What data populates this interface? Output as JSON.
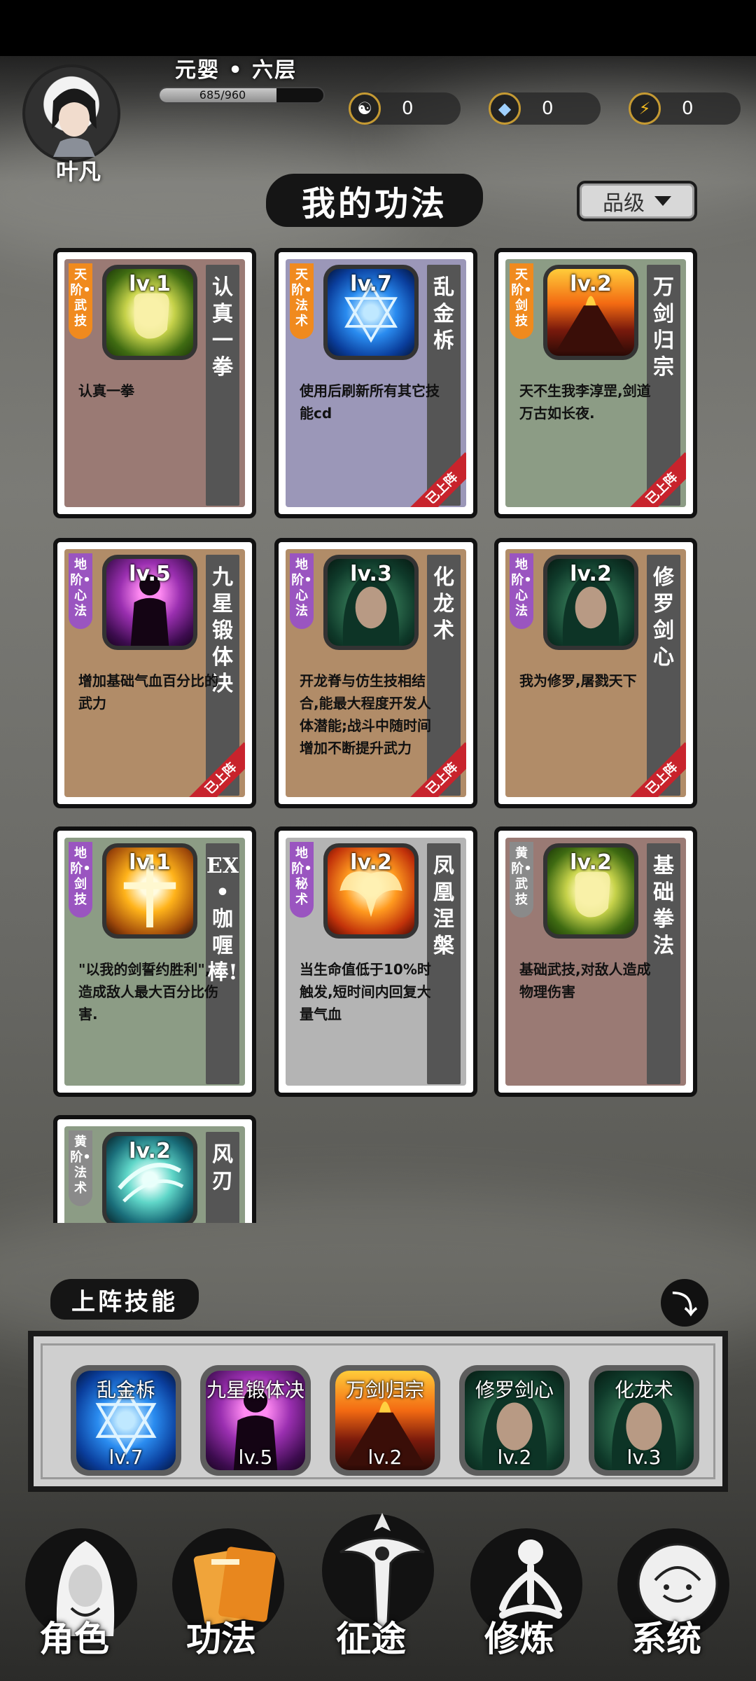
{
  "player": {
    "name": "叶凡",
    "realm": "元婴 • 六层",
    "exp_text": "685/960",
    "exp_fraction": 0.714
  },
  "resources": [
    {
      "icon": "yin-yang-icon",
      "value": "0"
    },
    {
      "icon": "crystal-icon",
      "value": "0"
    },
    {
      "icon": "lightning-icon",
      "value": "0"
    }
  ],
  "page_title": "我的功法",
  "grade_filter": {
    "label": "品级"
  },
  "skills": [
    {
      "tier": "天阶•武技",
      "tier_color": "#f08a1e",
      "bg": "#9a7a74",
      "level": "lv.1",
      "name": "认真一拳",
      "desc": "认真一拳",
      "equipped": false,
      "art": "fist-gold"
    },
    {
      "tier": "天阶•法术",
      "tier_color": "#f08a1e",
      "bg": "#9b97b8",
      "level": "lv.7",
      "name": "乱金柝",
      "desc": "使用后刷新所有其它技能cd",
      "equipped": true,
      "art": "hexagram-blue"
    },
    {
      "tier": "天阶•剑技",
      "tier_color": "#f08a1e",
      "bg": "#8c9c85",
      "level": "lv.2",
      "name": "万剑归宗",
      "desc": "天不生我李淳罡,剑道万古如长夜.",
      "equipped": true,
      "art": "volcano"
    },
    {
      "tier": "地阶•心法",
      "tier_color": "#9a55c0",
      "bg": "#b18c68",
      "level": "lv.5",
      "name": "九星锻体决",
      "desc": "增加基础气血百分比的武力",
      "equipped": true,
      "art": "shadow-purple"
    },
    {
      "tier": "地阶•心法",
      "tier_color": "#9a55c0",
      "bg": "#b18c68",
      "level": "lv.3",
      "name": "化龙术",
      "desc": "开龙脊与仿生技相结合,能最大程度开发人体潜能;战斗中随时间增加不断提升武力",
      "equipped": true,
      "art": "hood-green"
    },
    {
      "tier": "地阶•心法",
      "tier_color": "#9a55c0",
      "bg": "#b18c68",
      "level": "lv.2",
      "name": "修罗剑心",
      "desc": "我为修罗,屠戮天下",
      "equipped": true,
      "art": "hood-green"
    },
    {
      "tier": "地阶•剑技",
      "tier_color": "#9a55c0",
      "bg": "#8c9c85",
      "level": "lv.1",
      "name": "EX•咖喱棒!",
      "desc": "\"以我的剑誓约胜利\",造成敌人最大百分比伤害.",
      "equipped": false,
      "art": "cross-gold"
    },
    {
      "tier": "地阶•秘术",
      "tier_color": "#9a55c0",
      "bg": "#b4b4b4",
      "level": "lv.2",
      "name": "凤凰涅槃",
      "desc": "当生命值低于10%时触发,短时间内回复大量气血",
      "equipped": false,
      "art": "phoenix"
    },
    {
      "tier": "黄阶•武技",
      "tier_color": "#8a8a8a",
      "bg": "#9a7a74",
      "level": "lv.2",
      "name": "基础拳法",
      "desc": "基础武技,对敌人造成物理伤害",
      "equipped": false,
      "art": "fist-gold"
    },
    {
      "tier": "黄阶•法术",
      "tier_color": "#8a8a8a",
      "bg": "#8c9c85",
      "level": "lv.2",
      "name": "风刃",
      "desc": "",
      "equipped": false,
      "art": "wind-teal"
    }
  ],
  "equipped_badge": "已上阵",
  "equipped_section": {
    "title": "上阵技能",
    "slots": [
      {
        "name": "乱金柝",
        "level": "lv.7",
        "art": "hexagram-blue"
      },
      {
        "name": "九星锻体决",
        "level": "lv.5",
        "art": "shadow-purple"
      },
      {
        "name": "万剑归宗",
        "level": "lv.2",
        "art": "volcano"
      },
      {
        "name": "修罗剑心",
        "level": "lv.2",
        "art": "hood-green"
      },
      {
        "name": "化龙术",
        "level": "lv.3",
        "art": "hood-green"
      }
    ]
  },
  "nav": [
    {
      "label": "角色",
      "icon": "hooded-figure-icon",
      "active": false
    },
    {
      "label": "功法",
      "icon": "scroll-book-icon",
      "active": true
    },
    {
      "label": "征途",
      "icon": "sword-emblem-icon",
      "active": false
    },
    {
      "label": "修炼",
      "icon": "meditation-icon",
      "active": false
    },
    {
      "label": "系统",
      "icon": "gear-character-icon",
      "active": false
    }
  ]
}
